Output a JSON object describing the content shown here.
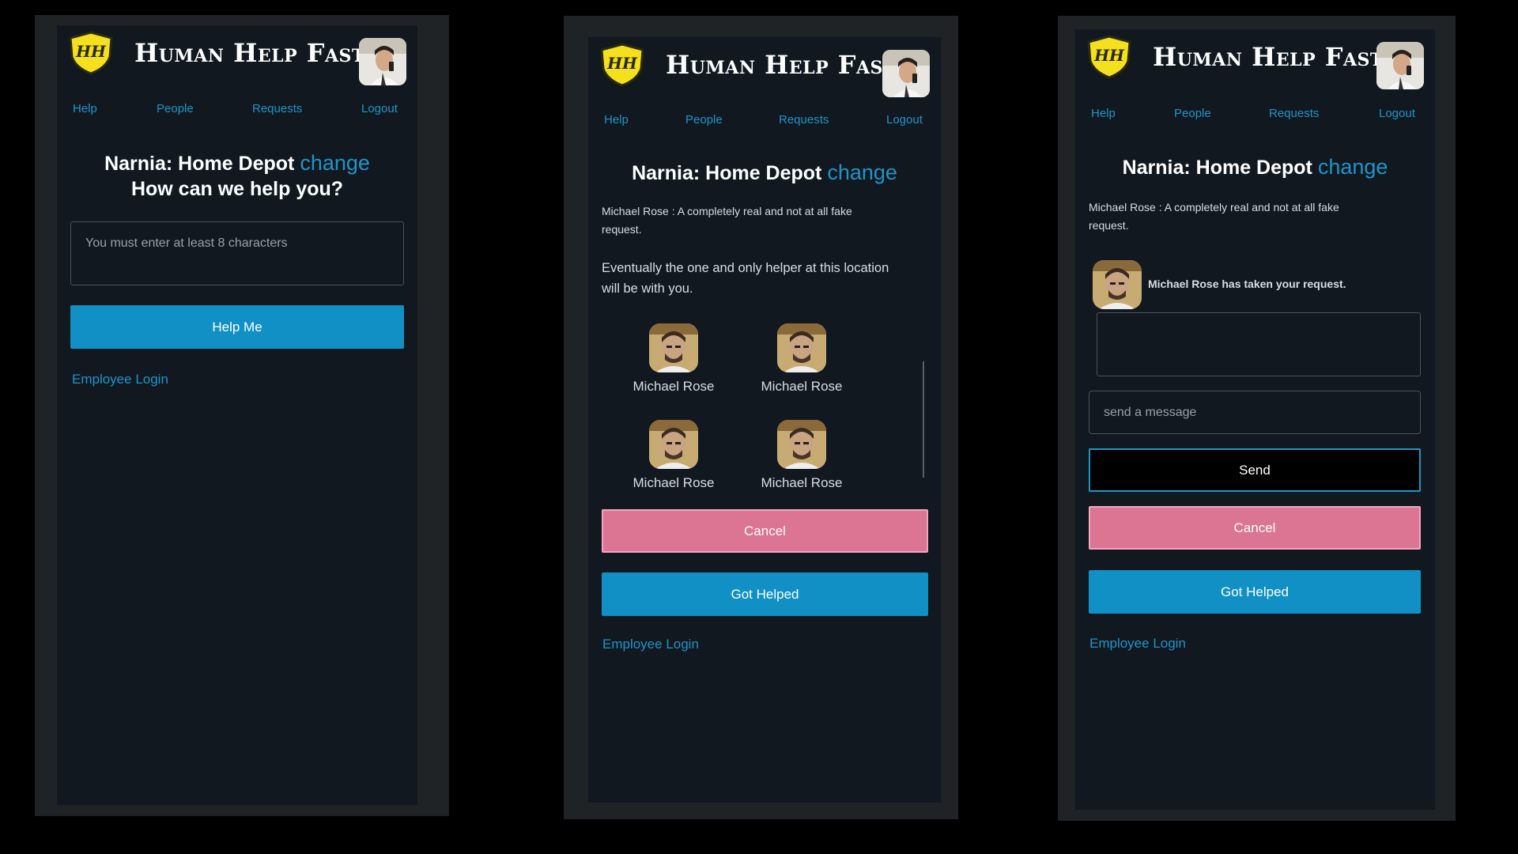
{
  "app": {
    "brand": "Human Help Fast",
    "logo_text": "HH",
    "colors": {
      "accent": "#1e95c9",
      "button_blue": "#1090c4",
      "button_pink": "#dc7493",
      "logo_yellow": "#f5e020",
      "background": "#111820"
    }
  },
  "nav": {
    "help": "Help",
    "people": "People",
    "requests": "Requests",
    "logout": "Logout"
  },
  "screen1": {
    "location": "Narnia: Home Depot",
    "change": "change",
    "prompt": "How can we help you?",
    "textarea_placeholder": "You must enter at least 8 characters",
    "help_button": "Help Me",
    "employee_login": "Employee Login"
  },
  "screen2": {
    "location": "Narnia: Home Depot",
    "change": "change",
    "request_line1": "Michael Rose : A completely real and not at all fake",
    "request_line2": "request.",
    "wait_line1": "Eventually the one and only helper at this location",
    "wait_line2": "will be with you.",
    "helpers": [
      "Michael Rose",
      "Michael Rose",
      "Michael Rose",
      "Michael Rose"
    ],
    "cancel_button": "Cancel",
    "got_helped_button": "Got Helped",
    "employee_login": "Employee Login"
  },
  "screen3": {
    "location": "Narnia: Home Depot",
    "change": "change",
    "request_line1": "Michael Rose : A completely real and not at all fake",
    "request_line2": "request.",
    "taken_message": "Michael Rose has taken your request.",
    "message_placeholder": "send a message",
    "send_button": "Send",
    "cancel_button": "Cancel",
    "got_helped_button": "Got Helped",
    "employee_login": "Employee Login"
  }
}
